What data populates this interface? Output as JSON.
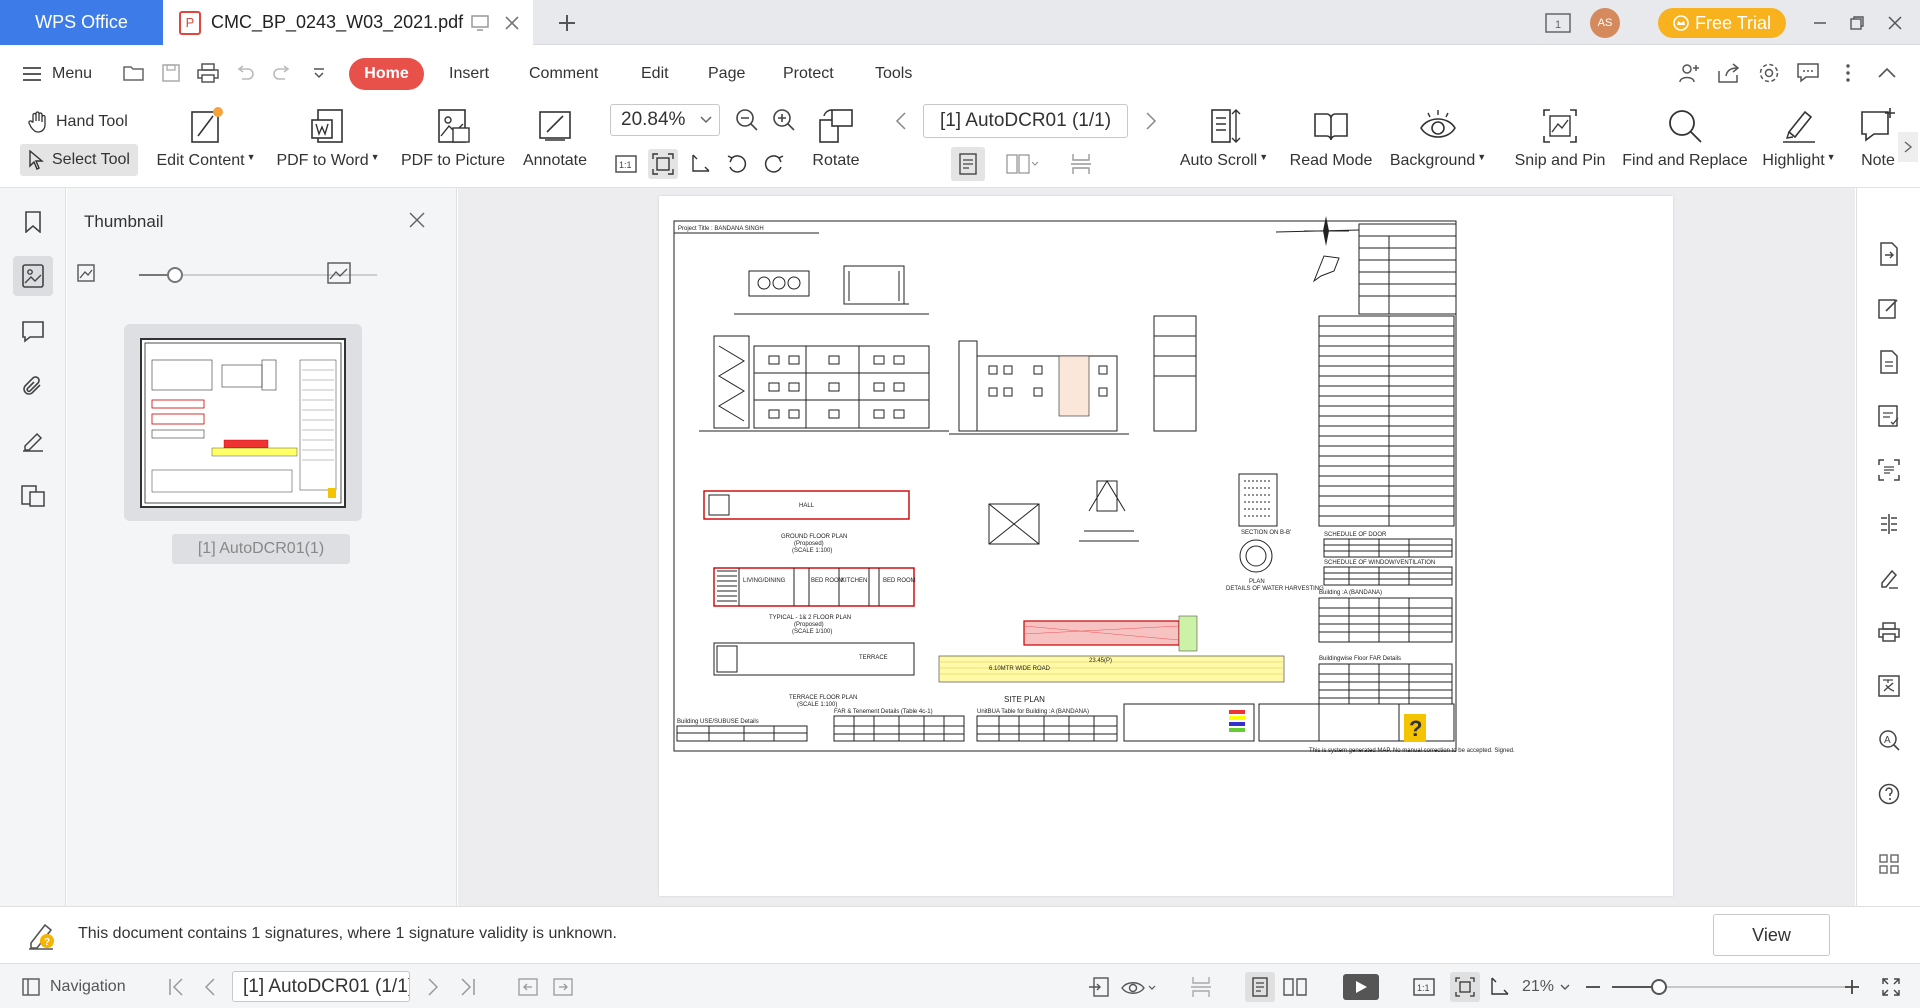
{
  "titlebar": {
    "app_name": "WPS Office",
    "doc_tab": "CMC_BP_0243_W03_2021.pdf",
    "avatar_initials": "AS",
    "free_trial": "Free Trial"
  },
  "menu": {
    "menu_label": "Menu",
    "tabs": [
      {
        "label": "Home",
        "active": true
      },
      {
        "label": "Insert"
      },
      {
        "label": "Comment"
      },
      {
        "label": "Edit"
      },
      {
        "label": "Page"
      },
      {
        "label": "Protect"
      },
      {
        "label": "Tools"
      }
    ]
  },
  "toolbar": {
    "hand_tool": "Hand Tool",
    "select_tool": "Select Tool",
    "edit_content": "Edit Content",
    "pdf_to_word": "PDF to Word",
    "pdf_to_picture": "PDF to Picture",
    "annotate": "Annotate",
    "zoom_value": "20.84%",
    "rotate": "Rotate",
    "page_indicator": "[1] AutoDCR01 (1/1)",
    "auto_scroll": "Auto Scroll",
    "read_mode": "Read Mode",
    "background": "Background",
    "snip_and_pin": "Snip and Pin",
    "find_and_replace": "Find and Replace",
    "highlight": "Highlight",
    "note": "Note",
    "actual_size": "1:1"
  },
  "thumbnail": {
    "title": "Thumbnail",
    "page_label": "[1] AutoDCR01(1)",
    "size_level": 0.15
  },
  "document": {
    "project_title": "Project Title : BANDANA SINGH",
    "section_labels": {
      "ground_floor": "GROUND FLOOR PLAN",
      "ground_floor_sub": "(Proposed)",
      "ground_floor_scale": "(SCALE 1:100)",
      "typical_floor": "TYPICAL - 1& 2 FLOOR PLAN",
      "typical_floor_sub": "(Proposed)",
      "typical_floor_scale": "(SCALE 1/100)",
      "terrace_floor": "TERRACE FLOOR PLAN",
      "terrace_floor_scale": "(SCALE 1:100)",
      "site_plan": "SITE PLAN",
      "terrace": "TERRACE",
      "schedule_door": "SCHEDULE OF DOOR",
      "schedule_window": "SCHEDULE OF WINDOW/VENTILATION",
      "building_a": "Building :A (BANDANA)",
      "buildingwise_far": "Buildingwise Floor FAR Details",
      "building_use": "Building USE/SUBUSE Details",
      "far_tenement": "FAR & Tenement Details (Table 4c-1)",
      "unitbua": "UnitBUA Table for Building :A (BANDANA)",
      "system_note": "This is system generated MAP. No manual correction to be accepted. Signed.",
      "living_dining": "LIVING/DINING",
      "bed_room": "BED ROOM",
      "kitchen": "KITCHEN",
      "hall": "HALL",
      "section_bb": "SECTION ON B-B'",
      "details_water": "DETAILS OF WATER HARVESTING",
      "plan": "PLAN",
      "road_width": "6.10MTR WIDE ROAD",
      "road_dim": "23.45(P)"
    }
  },
  "signature_bar": {
    "message": "This document contains 1 signatures, where 1 signature validity is unknown.",
    "view_button": "View"
  },
  "statusbar": {
    "navigation": "Navigation",
    "page_field": "[1] AutoDCR01 (1/1)",
    "zoom_percent": "21%",
    "actual_size": "1:1",
    "zoom_level": 0.2
  },
  "colors": {
    "accent_blue": "#3d7ce8",
    "home_red": "#e8514a",
    "free_trial_orange": "#f7b21e"
  }
}
